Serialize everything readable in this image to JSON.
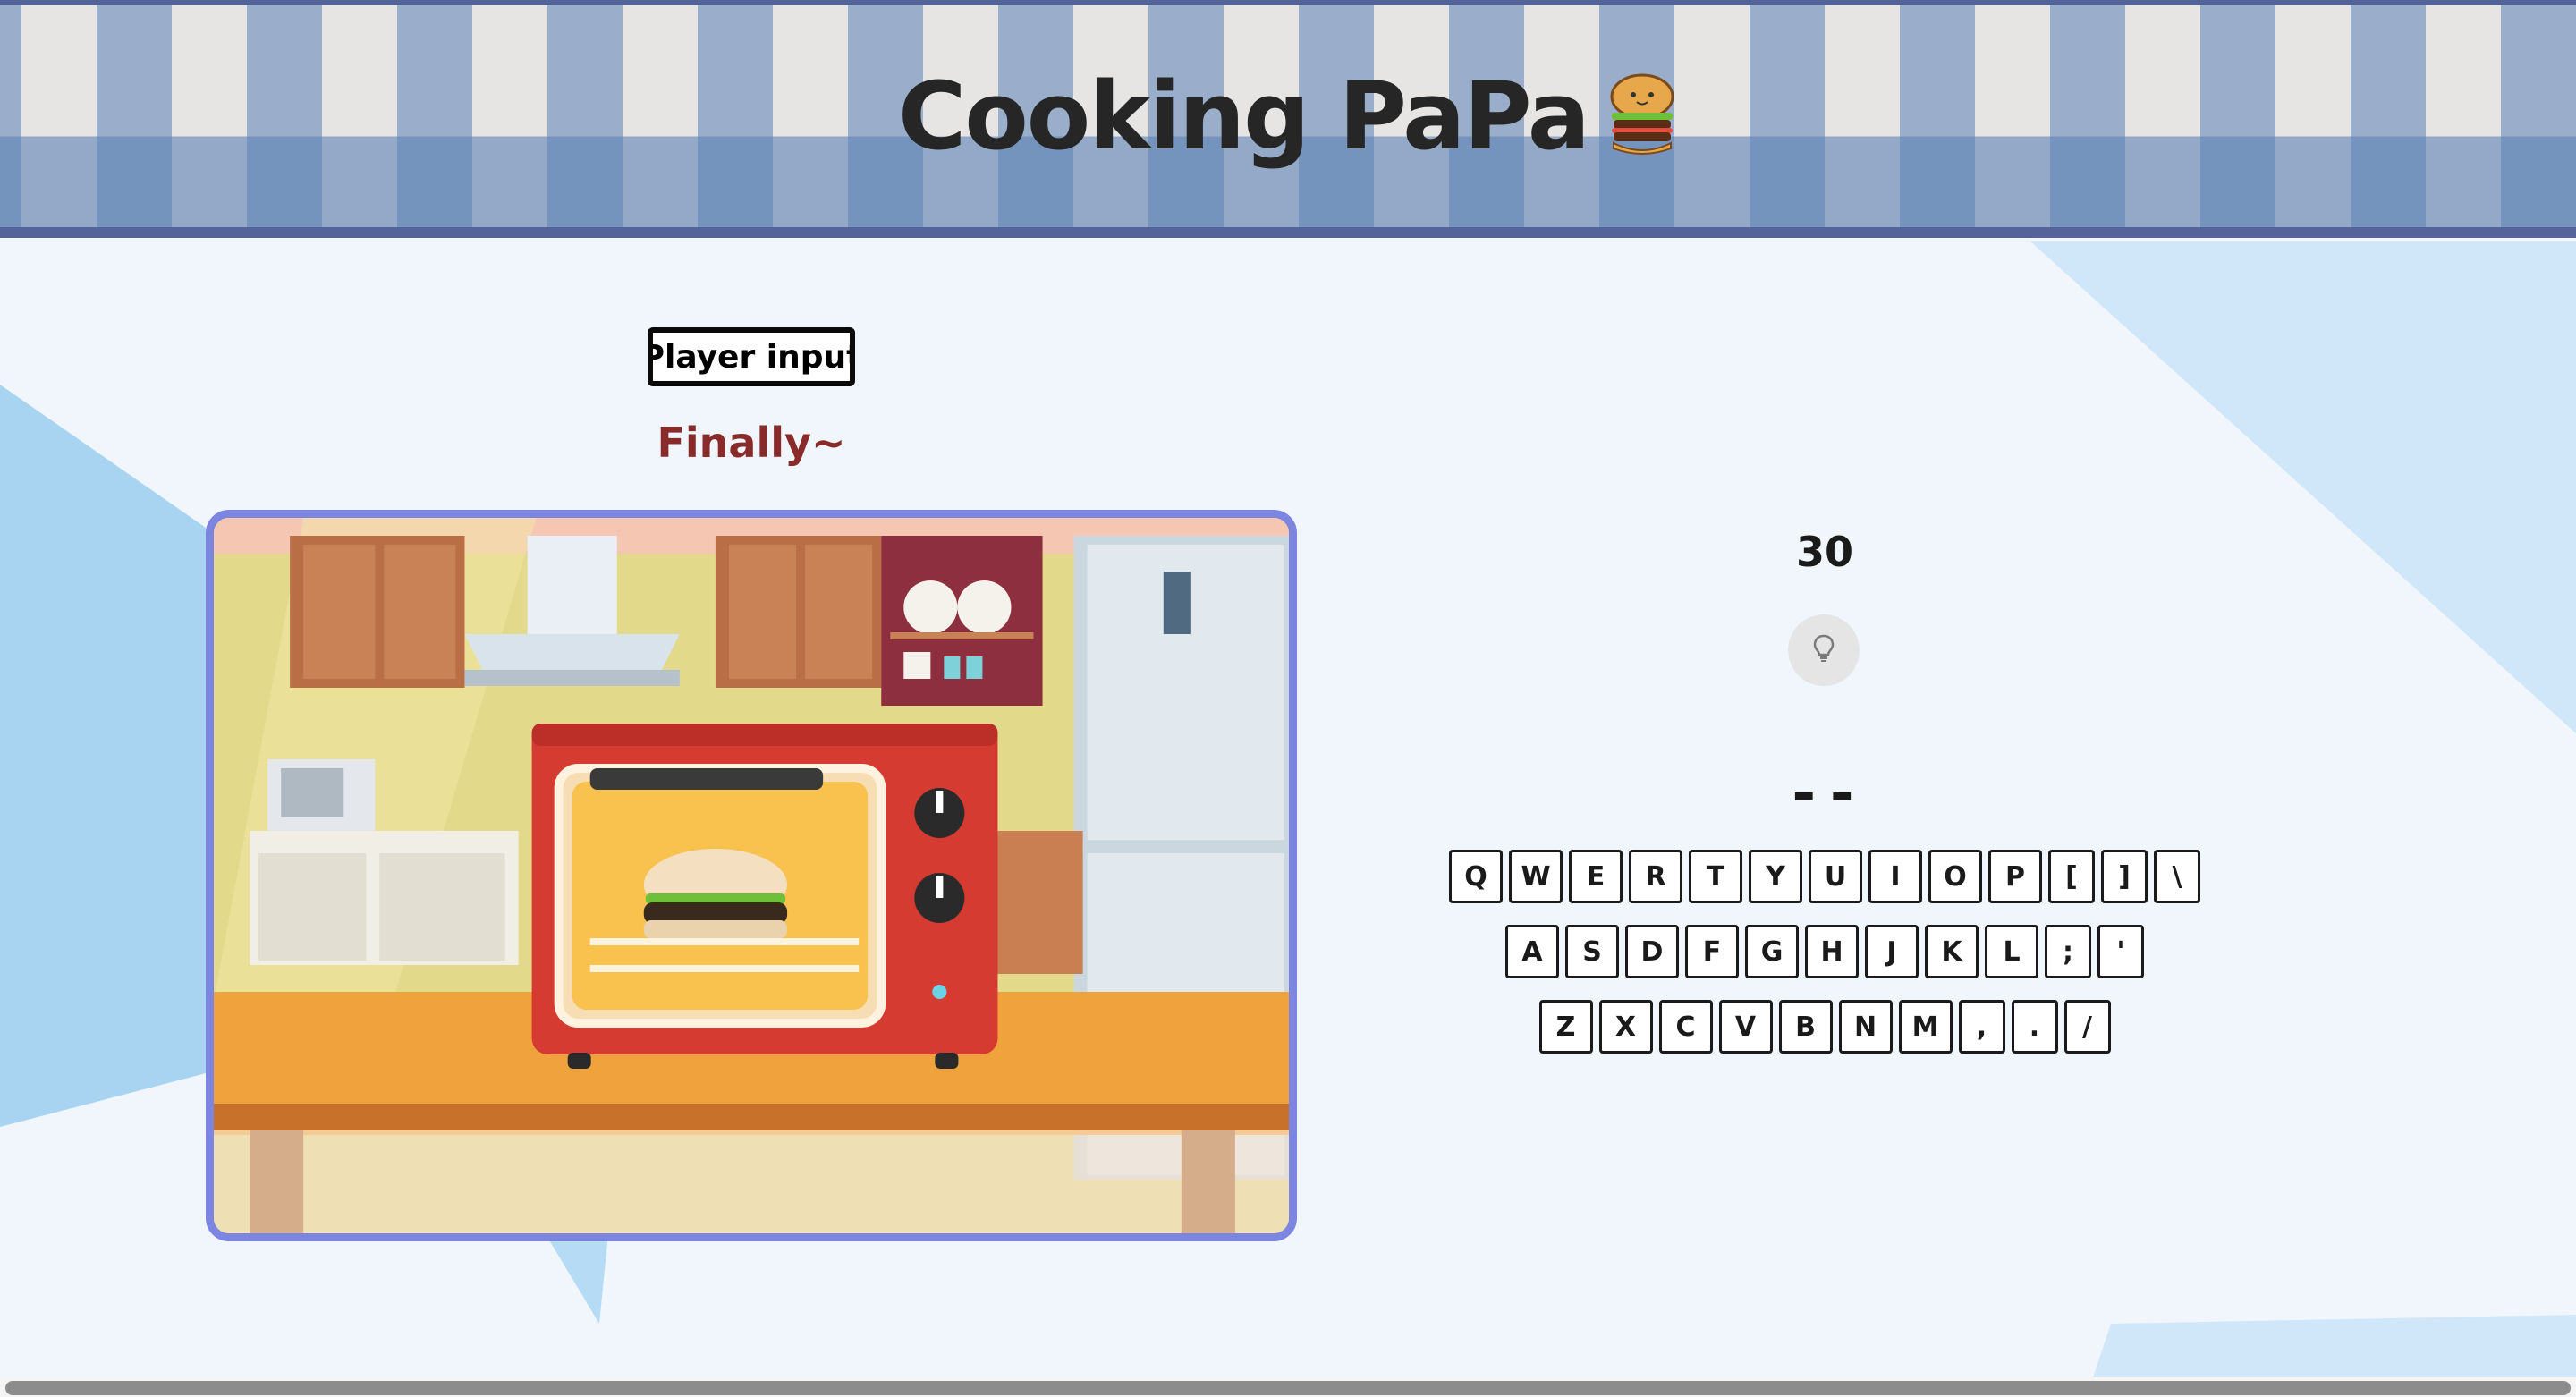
{
  "header": {
    "title": "Cooking PaPa",
    "icon": "hamburger-icon"
  },
  "game": {
    "player_input_label": "Player input",
    "status_text": "Finally~",
    "scene_icon": "oven-kitchen-illustration",
    "timer": "30",
    "hint_icon": "lightbulb-icon",
    "answer_blanks": "--"
  },
  "keyboard": {
    "row1": [
      "Q",
      "W",
      "E",
      "R",
      "T",
      "Y",
      "U",
      "I",
      "O",
      "P",
      "[",
      "]",
      "\\"
    ],
    "row2": [
      "A",
      "S",
      "D",
      "F",
      "G",
      "H",
      "J",
      "K",
      "L",
      ";",
      "'"
    ],
    "row3": [
      "Z",
      "X",
      "C",
      "V",
      "B",
      "N",
      "M",
      ",",
      ".",
      "/"
    ]
  },
  "colors": {
    "header_border": "#55639b",
    "scene_border": "#7c86e0",
    "status_text": "#8a2b2b",
    "background": "#f0f6fb",
    "accent_blue": "#bfe0f7"
  }
}
